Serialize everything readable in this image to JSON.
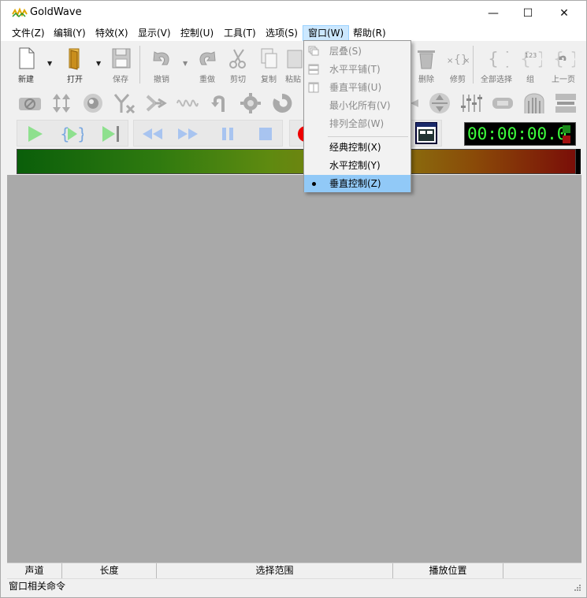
{
  "window": {
    "title": "GoldWave",
    "minimize": "—",
    "maximize": "☐",
    "close": "✕"
  },
  "menu": [
    {
      "label": "文件(Z)"
    },
    {
      "label": "编辑(Y)"
    },
    {
      "label": "特效(X)"
    },
    {
      "label": "显示(V)"
    },
    {
      "label": "控制(U)"
    },
    {
      "label": "工具(T)"
    },
    {
      "label": "选项(S)"
    },
    {
      "label": "窗口(W)"
    },
    {
      "label": "帮助(R)"
    }
  ],
  "toolbar": {
    "new": "新建",
    "open": "打开",
    "save": "保存",
    "undo": "撤销",
    "redo": "重做",
    "cut": "剪切",
    "copy": "复制",
    "paste": "粘贴",
    "delete": "删除",
    "trim": "修剪",
    "select_all": "全部选择",
    "group": "组",
    "prev_page": "上一页"
  },
  "timer": {
    "value": "00:00:00.0"
  },
  "dropdown": {
    "cascade": "层叠(S)",
    "tile_horizontal": "水平平铺(T)",
    "tile_vertical": "垂直平铺(U)",
    "minimize_all": "最小化所有(V)",
    "arrange_all": "排列全部(W)",
    "classic_control": "经典控制(X)",
    "horizontal_control": "水平控制(Y)",
    "vertical_control": "垂直控制(Z)"
  },
  "statusbar": {
    "channel": "声道",
    "length": "长度",
    "selection": "选择范围",
    "play_position": "播放位置",
    "command_hint": "窗口相关命令"
  },
  "colors": {
    "menu_active": "#cce8ff",
    "dropdown_checked": "#91c9f7",
    "timer_digits": "#3cff3c",
    "workspace": "#a9a9a9"
  }
}
